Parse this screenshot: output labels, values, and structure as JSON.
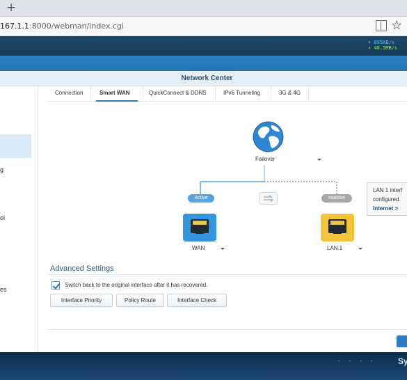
{
  "browser": {
    "new_tab_label": "+",
    "url_host": "167.1.1",
    "url_rest": ":8000/webman/index.cgi",
    "star_glyph": "☆"
  },
  "status": {
    "upload": "⬆ 895KB/s",
    "download": "⬇ 48.5MB/s"
  },
  "window": {
    "title": "Network Center"
  },
  "sidebar": {
    "fragments": [
      "g",
      "ol",
      "es"
    ]
  },
  "tabs": [
    "Connection",
    "Smart WAN",
    "QuickConnect & DDNS",
    "IPv6 Tunneling",
    "3G & 4G"
  ],
  "active_tab_index": 1,
  "diagram": {
    "mode_label": "Failover",
    "active_badge": "Active",
    "inactive_badge": "Inactive",
    "wan_label": "WAN",
    "lan_label": "LAN 1"
  },
  "tooltip": {
    "line1": "LAN 1 interf",
    "line2": "configured.",
    "link": "Internet >"
  },
  "advanced": {
    "title": "Advanced Settings",
    "checkbox_label": "Switch back to the original interface after it has recovered.",
    "checkbox_checked": true,
    "buttons": [
      "Interface Priority",
      "Policy Route",
      "Interface Check"
    ]
  },
  "desktop": {
    "brand": "Sy"
  },
  "colors": {
    "accent": "#2f7bc5",
    "wan_port": "#3595dc",
    "lan_port": "#f4c33a",
    "active_badge": "#5aa3dd",
    "inactive_badge": "#a8a8a8"
  }
}
